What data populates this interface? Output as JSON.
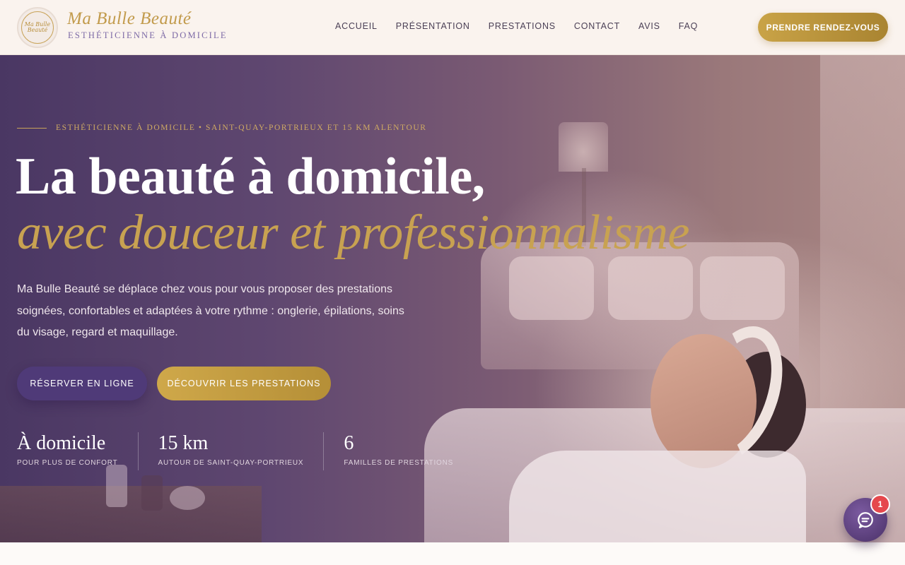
{
  "header": {
    "logo": {
      "line1": "Ma Bulle",
      "line2": "Beauté"
    },
    "brand_name": "Ma Bulle Beauté",
    "brand_subtitle": "ESTHÉTICIENNE À DOMICILE",
    "nav": [
      {
        "label": "ACCUEIL"
      },
      {
        "label": "PRÉSENTATION"
      },
      {
        "label": "PRESTATIONS"
      },
      {
        "label": "CONTACT"
      },
      {
        "label": "AVIS"
      },
      {
        "label": "FAQ"
      }
    ],
    "cta_label": "PRENDRE RENDEZ-VOUS"
  },
  "hero": {
    "eyebrow": "ESTHÉTICIENNE À DOMICILE • SAINT-QUAY-PORTRIEUX ET 15 KM ALENTOUR",
    "title_line1": "La beauté à domicile,",
    "title_line2": "avec douceur et professionnalisme",
    "description": "Ma Bulle Beauté se déplace chez vous pour vous proposer des prestations soignées, confortables et adaptées à votre rythme : onglerie, épilations, soins du visage, regard et maquillage.",
    "primary_button": "RÉSERVER EN LIGNE",
    "secondary_button": "DÉCOUVRIR LES PRESTATIONS",
    "stats": [
      {
        "value": "À domicile",
        "label": "POUR PLUS DE CONFORT"
      },
      {
        "value": "15 km",
        "label": "AUTOUR DE SAINT-QUAY-PORTRIEUX"
      },
      {
        "value": "6",
        "label": "FAMILLES DE PRESTATIONS"
      }
    ]
  },
  "chat": {
    "icon": "chat-bubble-icon",
    "badge_count": "1"
  },
  "colors": {
    "accent_gold": "#c8a251",
    "accent_purple": "#4f3a78",
    "header_bg": "#faf3ee",
    "badge_red": "#e5484d"
  }
}
